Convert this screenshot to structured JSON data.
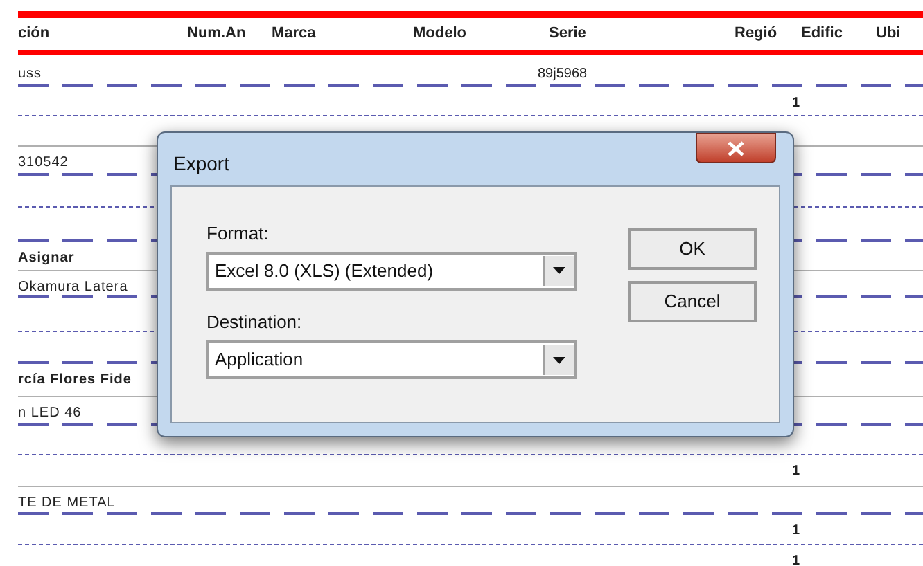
{
  "report": {
    "columns": [
      "ción",
      "Num.An",
      "Marca",
      "Modelo",
      "Serie",
      "Regió",
      "Edific",
      "Ubi"
    ],
    "rows": [
      {
        "kind": "item",
        "description": "uss",
        "serie": "89j5968",
        "bold": false
      },
      {
        "kind": "dashed"
      },
      {
        "kind": "count",
        "value": "1"
      },
      {
        "kind": "dotted"
      },
      {
        "kind": "blank"
      },
      {
        "kind": "solid"
      },
      {
        "kind": "item",
        "description": "310542",
        "bold": false
      },
      {
        "kind": "dashed"
      },
      {
        "kind": "blank"
      },
      {
        "kind": "dotted"
      },
      {
        "kind": "blank"
      },
      {
        "kind": "dashed"
      },
      {
        "kind": "item",
        "description": "Asignar",
        "bold": true
      },
      {
        "kind": "solid"
      },
      {
        "kind": "item",
        "description": "Okamura Latera",
        "bold": false
      },
      {
        "kind": "dashed"
      },
      {
        "kind": "blank"
      },
      {
        "kind": "dotted"
      },
      {
        "kind": "blank"
      },
      {
        "kind": "dashed"
      },
      {
        "kind": "item",
        "description": "rcía Flores Fide",
        "bold": true
      },
      {
        "kind": "solid"
      },
      {
        "kind": "item",
        "description": "n LED 46",
        "bold": false
      },
      {
        "kind": "dashed"
      },
      {
        "kind": "blank"
      },
      {
        "kind": "dotted"
      },
      {
        "kind": "count",
        "value": "1"
      },
      {
        "kind": "solid"
      },
      {
        "kind": "item",
        "description": "TE DE METAL",
        "bold": false
      },
      {
        "kind": "dashed"
      },
      {
        "kind": "count",
        "value": "1"
      },
      {
        "kind": "dotted"
      },
      {
        "kind": "count",
        "value": "1"
      }
    ]
  },
  "dialog": {
    "title": "Export",
    "format_label": "Format:",
    "format_value": "Excel 8.0 (XLS) (Extended)",
    "destination_label": "Destination:",
    "destination_value": "Application",
    "buttons": [
      "OK",
      "Cancel"
    ]
  }
}
